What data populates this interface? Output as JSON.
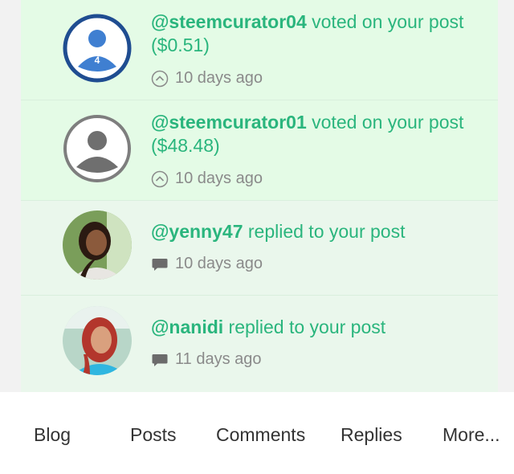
{
  "notifications": [
    {
      "user": "@steemcurator04",
      "action": " voted on your post",
      "amount": "($0.51)",
      "time": "10 days ago",
      "icon": "upvote-icon",
      "avatar": "curator-avatar-4",
      "avatar_number": "4"
    },
    {
      "user": "@steemcurator01",
      "action": " voted on your post",
      "amount": "($48.48)",
      "time": "10 days ago",
      "icon": "upvote-icon",
      "avatar": "default-avatar"
    },
    {
      "user": "@yenny47",
      "action": " replied to your post",
      "time": "10 days ago",
      "icon": "comment-icon",
      "avatar": "photo-avatar"
    },
    {
      "user": "@nanidi",
      "action": " replied to your post",
      "time": "11 days ago",
      "icon": "comment-icon",
      "avatar": "photo-avatar"
    }
  ],
  "tabs": [
    "Blog",
    "Posts",
    "Comments",
    "Replies",
    "More..."
  ],
  "colors": {
    "accent": "#2ab57d",
    "unread_bg": "#e4fbe6",
    "read_bg": "#eaf7ec",
    "avatar_blue": "#1f4d91"
  }
}
